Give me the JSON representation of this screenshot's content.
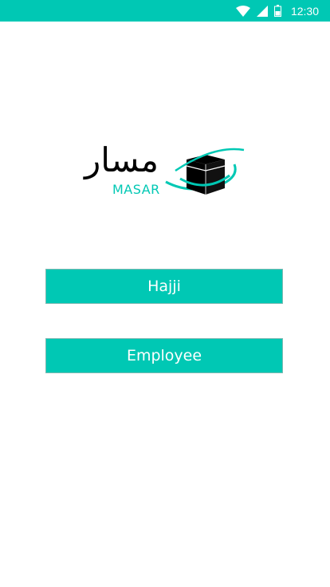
{
  "status_bar": {
    "time": "12:30",
    "icons": [
      "wifi-icon",
      "cell-signal-icon",
      "battery-icon"
    ],
    "background": "#00c8b4"
  },
  "logo": {
    "arabic_text": "مسار",
    "latin_text": "MASAR",
    "icon": "kaaba-icon"
  },
  "buttons": {
    "hajji_label": "Hajji",
    "employee_label": "Employee"
  },
  "colors": {
    "accent": "#00c8b4",
    "background": "#ffffff",
    "button_text": "#ffffff"
  }
}
